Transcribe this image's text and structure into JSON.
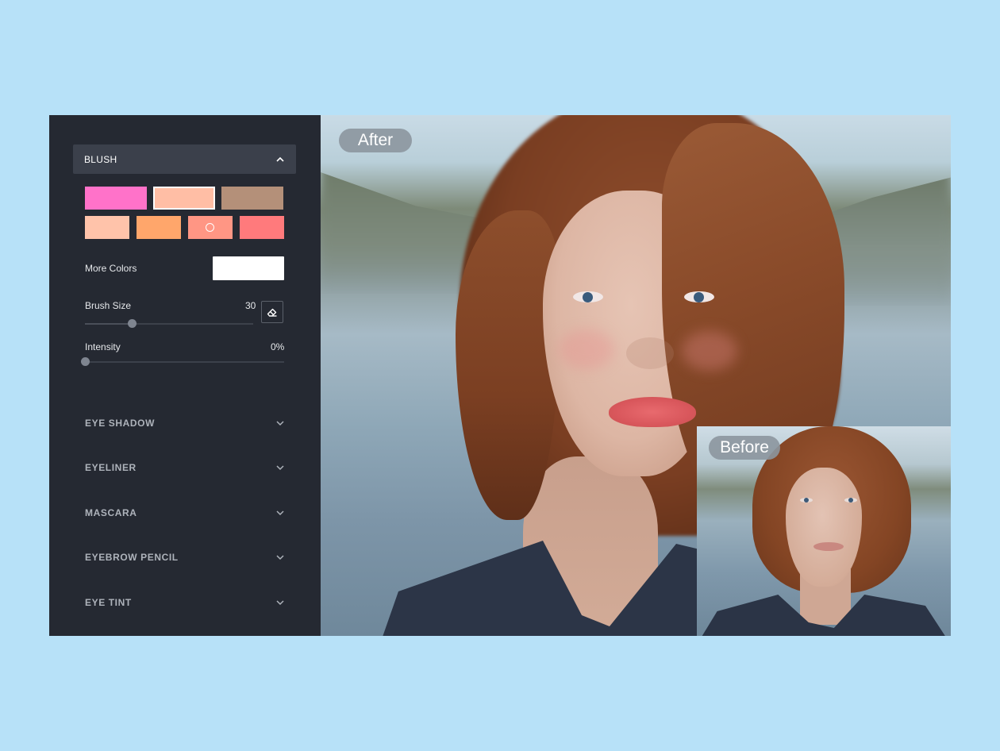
{
  "sidebar": {
    "section": {
      "title": "BLUSH",
      "expanded": true
    },
    "swatches_row1": [
      {
        "color": "#ff72c9",
        "selected": false
      },
      {
        "color": "#ffbea5",
        "selected": true
      },
      {
        "color": "#b49079",
        "selected": false
      }
    ],
    "swatches_row2": [
      {
        "color": "#ffc3aa",
        "selected": false
      },
      {
        "color": "#ffa66b",
        "selected": false
      },
      {
        "color": "#ff9684",
        "selected": false,
        "active_marker": true
      },
      {
        "color": "#ff7a7c",
        "selected": false
      }
    ],
    "more_colors": {
      "label": "More Colors",
      "value": "#ffffff"
    },
    "brush_size": {
      "label": "Brush Size",
      "value": "30",
      "fraction": 0.28
    },
    "intensity": {
      "label": "Intensity",
      "value": "0%",
      "fraction": 0
    },
    "accordion": [
      {
        "label": "EYE SHADOW"
      },
      {
        "label": "EYELINER"
      },
      {
        "label": "MASCARA"
      },
      {
        "label": "EYEBROW PENCIL"
      },
      {
        "label": "EYE TINT"
      }
    ]
  },
  "preview": {
    "after_label": "After",
    "before_label": "Before"
  },
  "colors": {
    "page_background": "#b7e1f8",
    "sidebar_background": "#252932",
    "section_header_background": "#3b404b"
  },
  "icons": {
    "section_toggle": "chevron-up-icon",
    "accordion_toggle": "chevron-down-icon",
    "eraser": "eraser-icon"
  }
}
